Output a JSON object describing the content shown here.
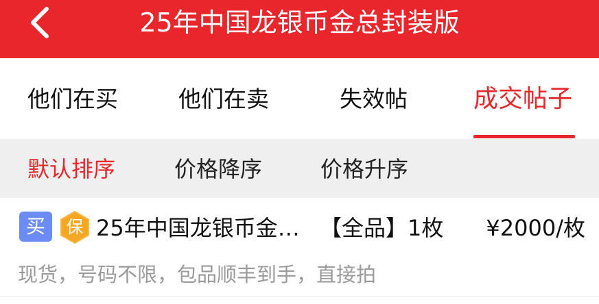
{
  "header": {
    "title": "25年中国龙银币金总封装版",
    "background": "#e8262b"
  },
  "tabs": [
    {
      "label": "他们在买",
      "active": false
    },
    {
      "label": "他们在卖",
      "active": false
    },
    {
      "label": "失效帖",
      "active": false
    },
    {
      "label": "成交帖子",
      "active": true
    }
  ],
  "sort": [
    {
      "label": "默认排序",
      "active": true
    },
    {
      "label": "价格降序",
      "active": false
    },
    {
      "label": "价格升序",
      "active": false
    }
  ],
  "items": [
    {
      "type_badge": "买",
      "guarantee_badge": "保",
      "title": "25年中国龙银币金…",
      "condition": "【全品】1枚",
      "price": "¥2000/枚",
      "description": "现货，号码不限，包品顺丰到手，直接拍"
    }
  ],
  "colors": {
    "accent": "#e8262b",
    "buy_badge": "#6c8cf5",
    "guarantee_badge": "#f5a623"
  }
}
